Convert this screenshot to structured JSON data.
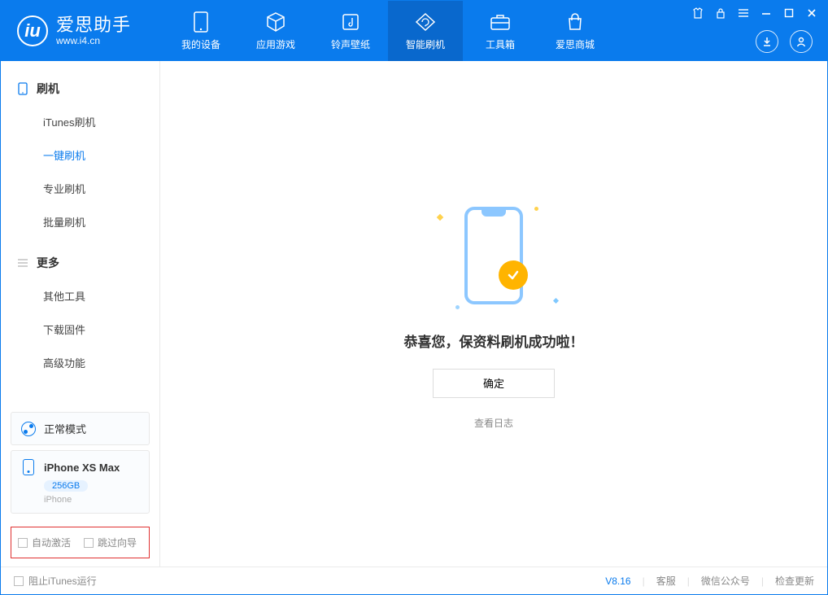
{
  "app": {
    "logo_title": "爱思助手",
    "logo_sub": "www.i4.cn"
  },
  "tabs": [
    {
      "label": "我的设备",
      "icon": "device-icon"
    },
    {
      "label": "应用游戏",
      "icon": "cube-icon"
    },
    {
      "label": "铃声壁纸",
      "icon": "music-icon"
    },
    {
      "label": "智能刷机",
      "icon": "refresh-icon"
    },
    {
      "label": "工具箱",
      "icon": "toolbox-icon"
    },
    {
      "label": "爱思商城",
      "icon": "store-icon"
    }
  ],
  "sidebar": {
    "section1": {
      "title": "刷机",
      "items": [
        "iTunes刷机",
        "一键刷机",
        "专业刷机",
        "批量刷机"
      ]
    },
    "section2": {
      "title": "更多",
      "items": [
        "其他工具",
        "下载固件",
        "高级功能"
      ]
    }
  },
  "device": {
    "mode_label": "正常模式",
    "name": "iPhone XS Max",
    "storage": "256GB",
    "type": "iPhone"
  },
  "options": {
    "auto_activate": "自动激活",
    "skip_guide": "跳过向导"
  },
  "main": {
    "success_message": "恭喜您，保资料刷机成功啦！",
    "ok_button": "确定",
    "view_log": "查看日志"
  },
  "footer": {
    "block_itunes": "阻止iTunes运行",
    "version": "V8.16",
    "customer_service": "客服",
    "wechat": "微信公众号",
    "check_update": "检查更新"
  }
}
